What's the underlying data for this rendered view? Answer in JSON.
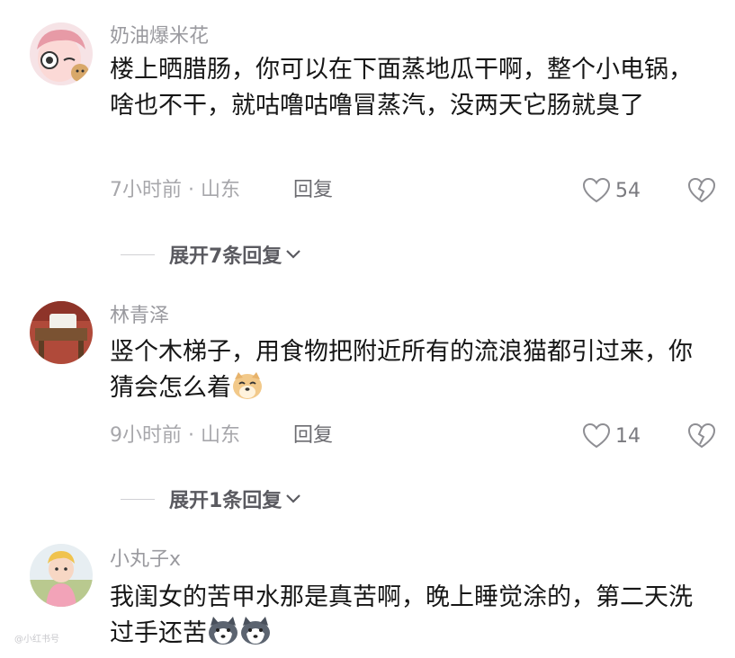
{
  "comments": [
    {
      "username": "奶油爆米花",
      "text": "楼上晒腊肠，你可以在下面蒸地瓜干啊，整个小电锅，啥也不干，就咕噜咕噜冒蒸汽，没两天它肠就臭了",
      "meta": "7小时前 · 山东",
      "reply_label": "回复",
      "likes": "54",
      "expand_label": "展开7条回复",
      "avatar_icon": "cartoon-girl-avatar"
    },
    {
      "username": "林青泽",
      "text": "竖个木梯子，用食物把附近所有的流浪猫都引过来，你猜会怎么着",
      "emoji": "doge-emoji",
      "meta": "9小时前 · 山东",
      "reply_label": "回复",
      "likes": "14",
      "expand_label": "展开1条回复",
      "avatar_icon": "bench-photo-avatar"
    },
    {
      "username": "小丸子x",
      "text": "我闺女的苦甲水那是真苦啊，晚上睡觉涂的，第二天洗过手还苦",
      "emoji": "husky-emoji",
      "avatar_icon": "child-photo-avatar"
    }
  ],
  "watermark": "@小红书号"
}
